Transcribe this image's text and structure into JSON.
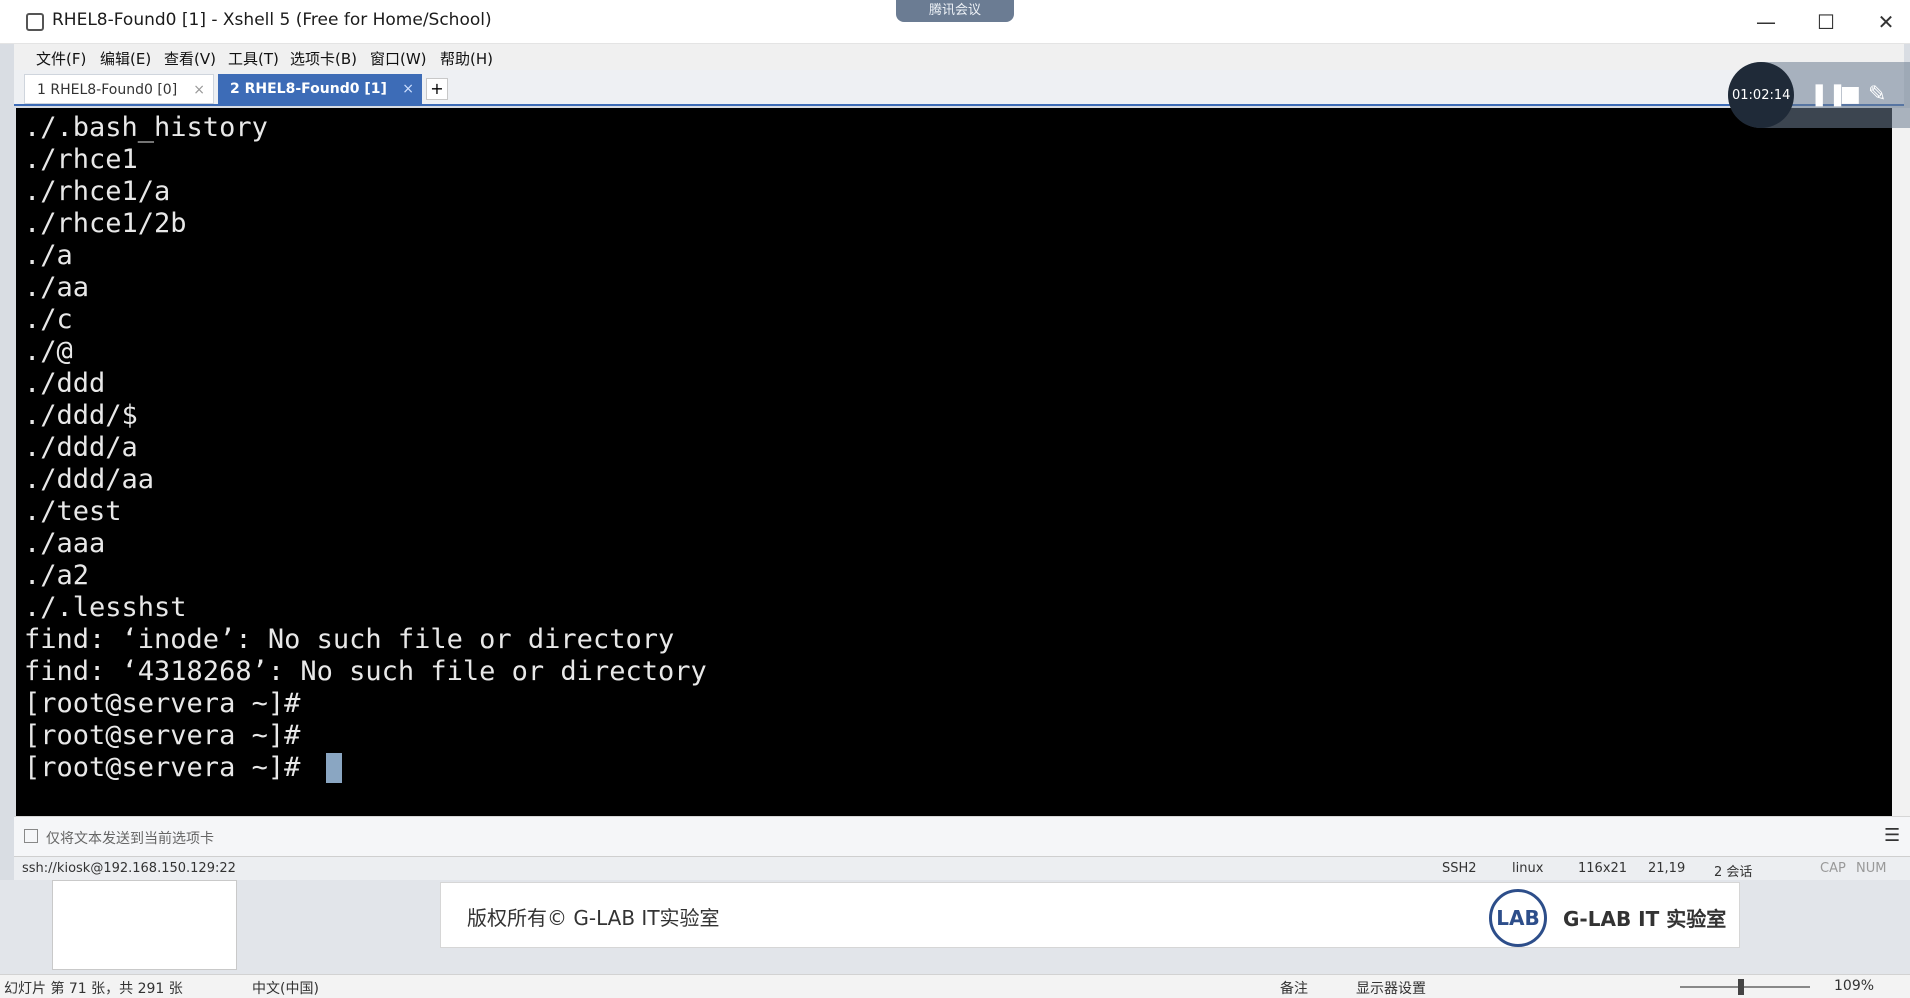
{
  "window": {
    "title": "RHEL8-Found0 [1] - Xshell 5 (Free for Home/School)",
    "meeting_label": "腾讯会议",
    "controls": [
      "—",
      "☐",
      "✕"
    ]
  },
  "menu": [
    "文件(F)",
    "编辑(E)",
    "查看(V)",
    "工具(T)",
    "选项卡(B)",
    "窗口(W)",
    "帮助(H)"
  ],
  "tabs": [
    {
      "label": "1 RHEL8-Found0 [0]",
      "close": "×"
    },
    {
      "label": "2 RHEL8-Found0 [1]",
      "close": "×"
    }
  ],
  "tab_add": "+",
  "terminal": {
    "lines": [
      "./.bash_history",
      "./rhce1",
      "./rhce1/a",
      "./rhce1/2b",
      "./a",
      "./aa",
      "./c",
      "./@",
      "./ddd",
      "./ddd/$",
      "./ddd/a",
      "./ddd/aa",
      "./test",
      "./aaa",
      "./a2",
      "./.lesshst",
      "find: ‘inode’: No such file or directory",
      "find: ‘4318268’: No such file or directory",
      "[root@servera ~]#",
      "[root@servera ~]#",
      "[root@servera ~]# "
    ]
  },
  "compose": {
    "placeholder": "仅将文本发送到当前选项卡"
  },
  "status": {
    "connection": "ssh://kiosk@192.168.150.129:22",
    "protocol": "SSH2",
    "term": "linux",
    "size": "116x21",
    "cursor_pos": "21,19",
    "sessions": "2 会话",
    "cap": "CAP",
    "num": "NUM"
  },
  "recording": {
    "time": "01:02:14"
  },
  "slide_footer": {
    "copyright": "版权所有© G-LAB IT实验室",
    "logo_text": "LAB",
    "lab_name": "G-LAB IT 实验室"
  },
  "ppt_status": {
    "slide_info": "幻灯片 第 71 张，共 291 张",
    "language": "中文(中国)",
    "notes": "备注",
    "display_settings": "显示器设置",
    "zoom": "109%"
  }
}
